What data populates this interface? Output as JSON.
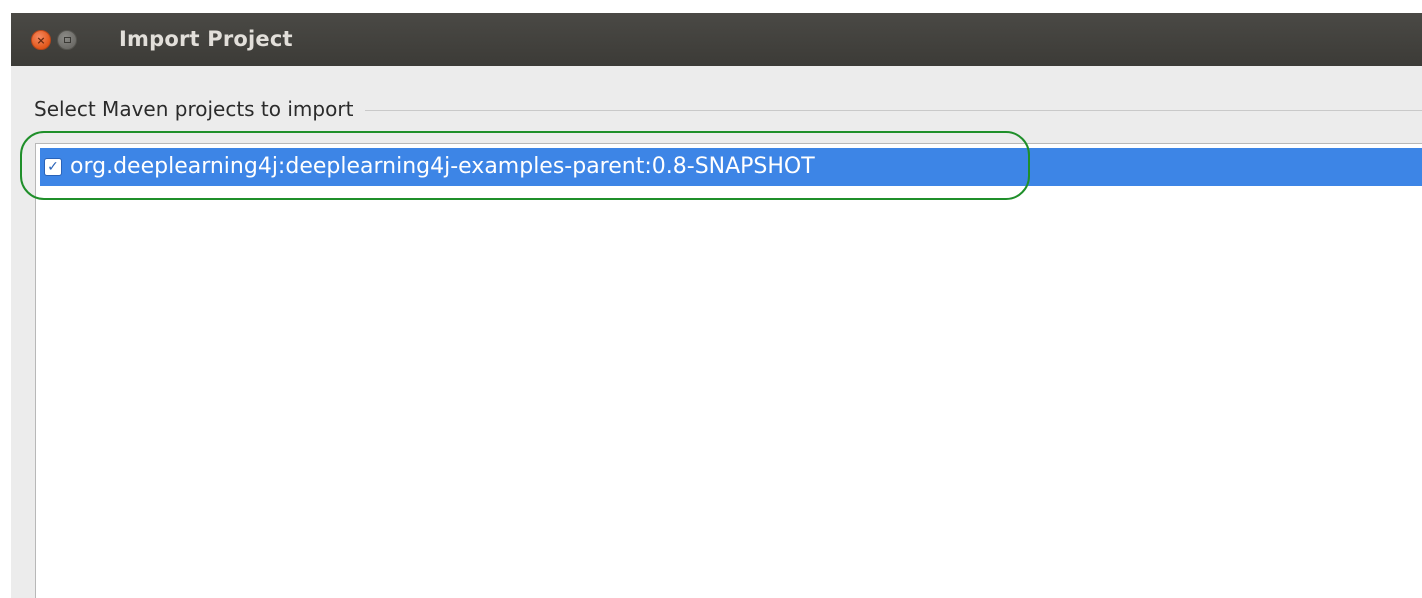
{
  "window": {
    "title": "Import Project",
    "controls": {
      "close": "close-icon",
      "maximize": "maximize-icon"
    }
  },
  "group": {
    "label": "Select Maven projects to import"
  },
  "projects": [
    {
      "label": "org.deeplearning4j:deeplearning4j-examples-parent:0.8-SNAPSHOT",
      "checked": true,
      "selected": true
    }
  ],
  "colors": {
    "titlebar": "#3c3b37",
    "selection": "#3d85e6",
    "highlight_annotation": "#1f8f2a",
    "close_button": "#e2571a"
  }
}
